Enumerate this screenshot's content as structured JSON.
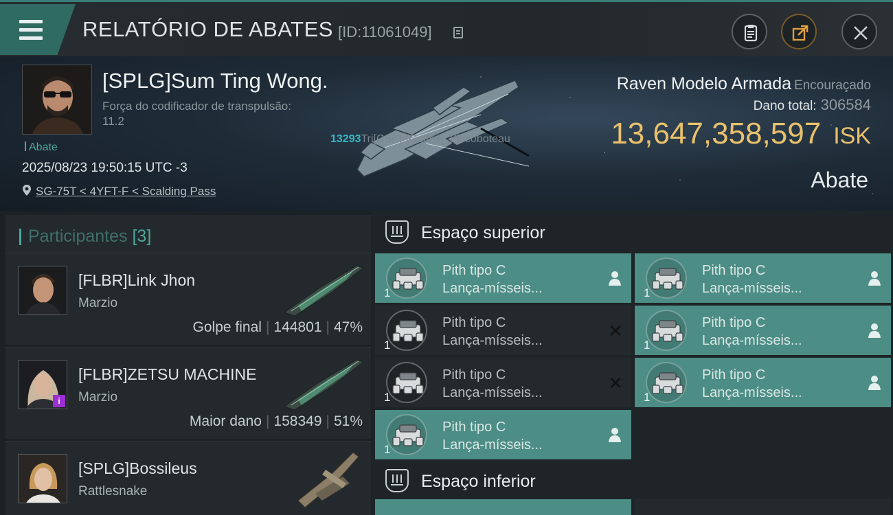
{
  "header": {
    "title": "RELATÓRIO DE ABATES",
    "report_id": "[ID:11061049]"
  },
  "victim": {
    "name": "[SPLG]Sum Ting Wong.",
    "subtitle": "Força do codificador de transpulsão:",
    "subtitle_value": "11.2",
    "tag": "Abate",
    "timestamp": "2025/08/23 19:50:15 UTC -3",
    "location": "SG-75T < 4YFT-F < Scalding Pass",
    "overlay_number": "13293",
    "overlay_text": "Tri[CSK]-[Geltrix]_Piccoboteau",
    "ship_name": "Raven Modelo Armada",
    "ship_class": "Encouraçado",
    "damage_label": "Dano total:",
    "damage_value": "306584",
    "isk_amount": "13,647,358,597",
    "isk_unit": "ISK",
    "kill_label": "Abate"
  },
  "participants": {
    "label": "Participantes",
    "count": "[3]",
    "items": [
      {
        "name": "[FLBR]Link Jhon",
        "ship": "Marzio",
        "stat_label": "Golpe final",
        "damage": "144801",
        "percent": "47%"
      },
      {
        "name": "[FLBR]ZETSU MACHINE",
        "ship": "Marzio",
        "stat_label": "Maior dano",
        "damage": "158349",
        "percent": "51%"
      },
      {
        "name": "[SPLG]Bossileus",
        "ship": "Rattlesnake",
        "stat_label": "",
        "damage": "",
        "percent": ""
      }
    ]
  },
  "modules": {
    "upper_label": "Espaço superior",
    "lower_label": "Espaço inferior",
    "items": [
      {
        "line1": "Pith tipo C",
        "line2": "Lança-mísseis...",
        "qty": "1",
        "status": "pilot"
      },
      {
        "line1": "Pith tipo C",
        "line2": "Lança-mísseis...",
        "qty": "1",
        "status": "pilot"
      },
      {
        "line1": "Pith tipo C",
        "line2": "Lança-mísseis...",
        "qty": "1",
        "status": "destroyed"
      },
      {
        "line1": "Pith tipo C",
        "line2": "Lança-mísseis...",
        "qty": "1",
        "status": "pilot"
      },
      {
        "line1": "Pith tipo C",
        "line2": "Lança-mísseis...",
        "qty": "1",
        "status": "destroyed"
      },
      {
        "line1": "Pith tipo C",
        "line2": "Lança-mísseis...",
        "qty": "1",
        "status": "pilot"
      },
      {
        "line1": "Pith tipo C",
        "line2": "Lança-mísseis...",
        "qty": "1",
        "status": "pilot"
      }
    ]
  },
  "icons": {
    "menu": "menu-icon",
    "copy": "copy-icon",
    "clipboard": "clipboard-icon",
    "share": "share-icon",
    "close": "close-icon",
    "location": "location-pin-icon",
    "slot": "shield-slot-icon",
    "pilot": "pilot-icon",
    "destroyed": "x-mark-icon"
  },
  "colors": {
    "accent": "#4ea79c",
    "isk": "#e9c16c",
    "module_fitted": "#4c8d85",
    "module_destroyed": "#24292d",
    "overlay_number": "#37b7c6"
  }
}
